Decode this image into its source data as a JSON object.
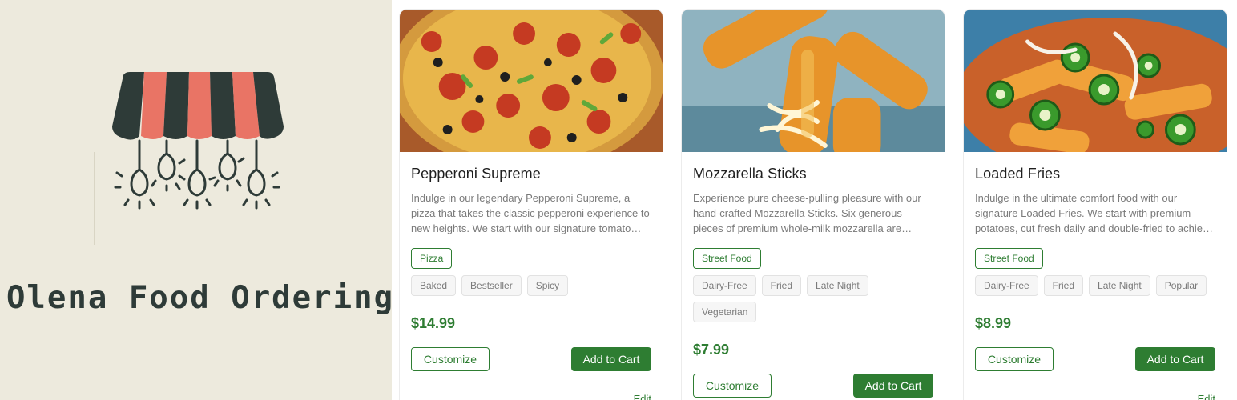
{
  "brand": {
    "title": "Olena Food Ordering",
    "colors": {
      "panel_bg": "#edeadd",
      "awning_dark": "#2e3b38",
      "awning_red": "#e97465"
    },
    "logo_icon": "storefront-awning-lightbulbs-icon"
  },
  "accent_color": "#2e7d32",
  "products": [
    {
      "name": "Pepperoni Supreme",
      "image_icon": "pizza-image",
      "description": "Indulge in our legendary Pepperoni Supreme, a pizza that takes the classic pepperoni experience to new heights. We start with our signature tomato sauce, layered with mozzarella and loaded with crispy pepperoni.",
      "category": "Pizza",
      "tags": [
        "Baked",
        "Bestseller",
        "Spicy"
      ],
      "price": "$14.99",
      "customize_label": "Customize",
      "add_to_cart_label": "Add to Cart",
      "edit_label": "Edit"
    },
    {
      "name": "Mozzarella Sticks",
      "image_icon": "mozzarella-sticks-image",
      "description": "Experience pure cheese-pulling pleasure with our hand-crafted Mozzarella Sticks. Six generous pieces of premium whole-milk mozzarella are coated in our seasoned breading and fried golden.",
      "category": "Street Food",
      "tags": [
        "Dairy-Free",
        "Fried",
        "Late Night",
        "Vegetarian"
      ],
      "price": "$7.99",
      "customize_label": "Customize",
      "add_to_cart_label": "Add to Cart"
    },
    {
      "name": "Loaded Fries",
      "image_icon": "loaded-fries-image",
      "description": "Indulge in the ultimate comfort food with our signature Loaded Fries. We start with premium potatoes, cut fresh daily and double-fried to achieve the perfect crunch.",
      "category": "Street Food",
      "tags": [
        "Dairy-Free",
        "Fried",
        "Late Night",
        "Popular"
      ],
      "price": "$8.99",
      "customize_label": "Customize",
      "add_to_cart_label": "Add to Cart",
      "edit_label": "Edit"
    }
  ]
}
